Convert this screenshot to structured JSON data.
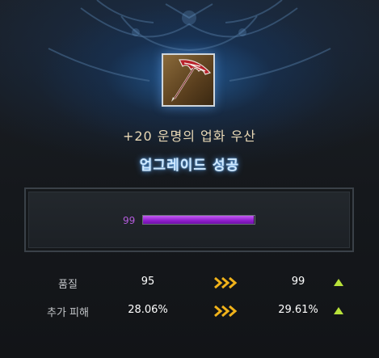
{
  "item": {
    "name": "+20 운명의 업화 우산",
    "icon": "crimson-umbrella-weapon-icon"
  },
  "result_text": "업그레이드 성공",
  "quality_bar": {
    "value_label": "99",
    "fill_percent": 99,
    "color": "#9a2fd6"
  },
  "stats": [
    {
      "label": "품질",
      "before": "95",
      "after": "99",
      "trend": "up"
    },
    {
      "label": "추가 피해",
      "before": "28.06%",
      "after": "29.61%",
      "trend": "up"
    }
  ],
  "colors": {
    "accent_glow": "#5aaaff",
    "arrow": "#f0b21a",
    "up_indicator": "#b8e23a"
  }
}
